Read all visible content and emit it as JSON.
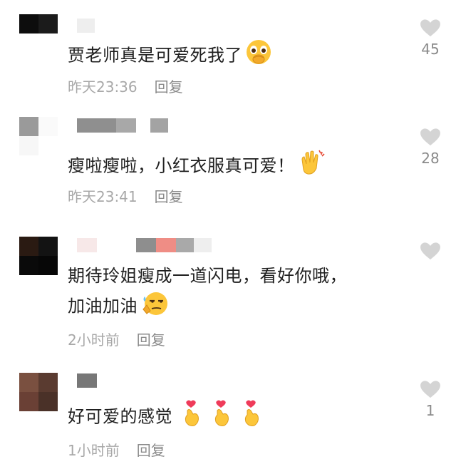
{
  "comments": [
    {
      "text": "贾老师真是可爱死我了",
      "emoji": "hand-over-mouth-emoji",
      "time": "昨天23:36",
      "reply": "回复",
      "likes": "45"
    },
    {
      "text": "瘦啦瘦啦，小红衣服真可爱！",
      "emoji": "clapping-hands-emoji",
      "time": "昨天23:41",
      "reply": "回复",
      "likes": "28"
    },
    {
      "text_line1": "期待玲姐瘦成一道闪电，看好你哦，",
      "text_line2": "加油加油",
      "emoji": "smug-sweat-face-emoji",
      "time": "2小时前",
      "reply": "回复",
      "likes": ""
    },
    {
      "text": "好可爱的感觉",
      "emoji": "finger-heart-emoji",
      "time": "1小时前",
      "reply": "回复",
      "likes": "1"
    }
  ],
  "colors": {
    "text": "#1f1f1f",
    "meta": "#a8a8a8",
    "heart": "#d4d4d4"
  }
}
